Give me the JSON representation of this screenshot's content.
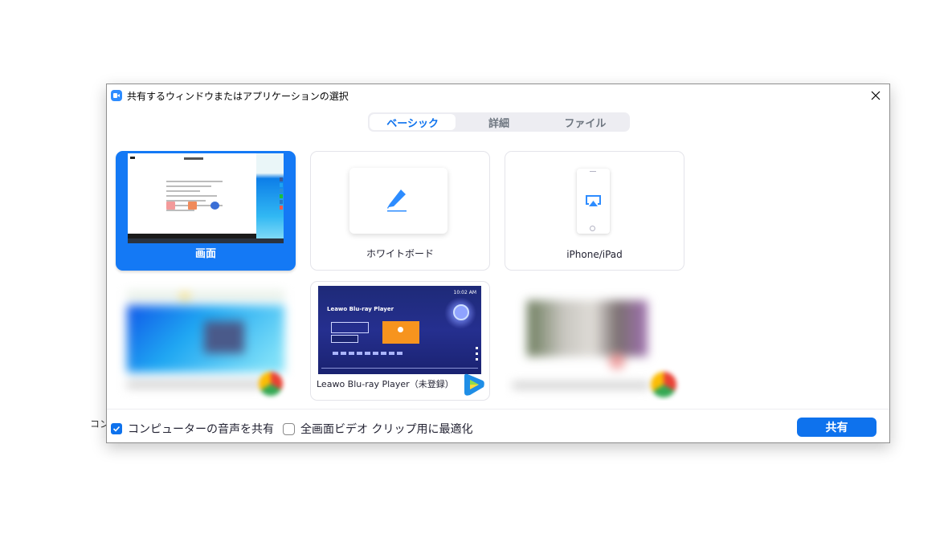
{
  "background": {
    "partial_label": "コン"
  },
  "dialog": {
    "title": "共有するウィンドウまたはアプリケーションの選択",
    "app_icon": "zoom-camera-icon",
    "close_icon": "close-icon"
  },
  "tabs": [
    {
      "label": "ベーシック",
      "active": true
    },
    {
      "label": "詳細",
      "active": false
    },
    {
      "label": "ファイル",
      "active": false
    }
  ],
  "sources": [
    {
      "label": "画面",
      "type": "screen",
      "selected": true
    },
    {
      "label": "ホワイトボード",
      "type": "whiteboard",
      "icon": "pen-icon",
      "selected": false
    },
    {
      "label": "iPhone/iPad",
      "type": "device",
      "icon": "airplay-icon",
      "selected": false
    },
    {
      "label": "",
      "type": "window-blurred",
      "app_icon": "chrome-icon",
      "selected": false
    },
    {
      "label": "Leawo Blu-ray Player（未登録）",
      "type": "window",
      "app_icon": "leawo-play-icon",
      "preview": {
        "title": "Leawo Blu-ray Player",
        "clock": "10:02 AM"
      },
      "selected": false
    },
    {
      "label": "",
      "type": "window-blurred",
      "app_icon": "chrome-icon",
      "selected": false
    }
  ],
  "options": {
    "share_audio": {
      "label": "コンピューターの音声を共有",
      "checked": true
    },
    "optimize_video": {
      "label": "全画面ビデオ クリップ用に最適化",
      "checked": false
    }
  },
  "share_button": {
    "label": "共有"
  },
  "colors": {
    "accent": "#0e72ed",
    "selected_card": "#1479f5",
    "leawo_orange": "#f7941e"
  }
}
